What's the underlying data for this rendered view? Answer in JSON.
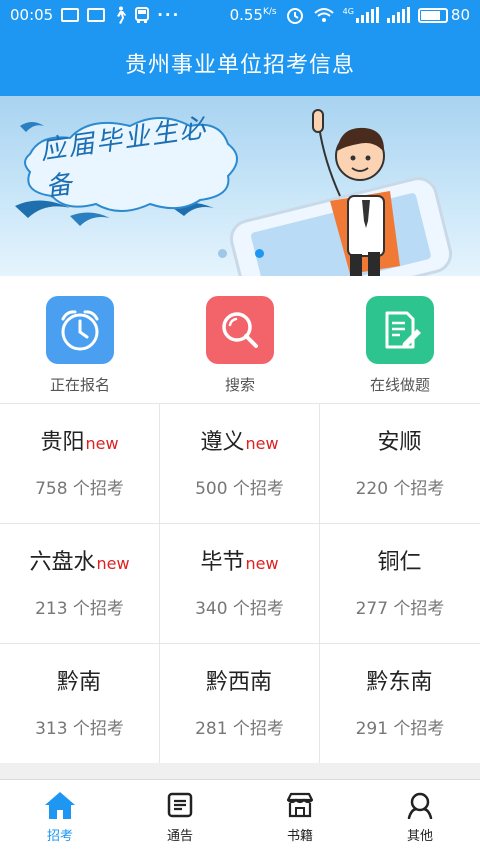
{
  "status_bar": {
    "time": "00:05",
    "more": "···",
    "speed_value": "0.55",
    "speed_unit": "K/s",
    "network_type": "4G",
    "battery_level": "80"
  },
  "header": {
    "title": "贵州事业单位招考信息"
  },
  "banner": {
    "slogan": "应届毕业生必备",
    "slide_count": 2,
    "active_slide": 2
  },
  "quick_actions": [
    {
      "label": "正在报名",
      "icon": "alarm-clock-icon",
      "color": "#4a9ff0"
    },
    {
      "label": "搜索",
      "icon": "magnifier-icon",
      "color": "#f2636a"
    },
    {
      "label": "在线做题",
      "icon": "document-edit-icon",
      "color": "#2ec48f"
    }
  ],
  "regions": [
    {
      "name": "贵阳",
      "badge": "new",
      "count": "758 个招考"
    },
    {
      "name": "遵义",
      "badge": "new",
      "count": "500 个招考"
    },
    {
      "name": "安顺",
      "badge": "",
      "count": "220 个招考"
    },
    {
      "name": "六盘水",
      "badge": "new",
      "count": "213 个招考"
    },
    {
      "name": "毕节",
      "badge": "new",
      "count": "340 个招考"
    },
    {
      "name": "铜仁",
      "badge": "",
      "count": "277 个招考"
    },
    {
      "name": "黔南",
      "badge": "",
      "count": "313 个招考"
    },
    {
      "name": "黔西南",
      "badge": "",
      "count": "281 个招考"
    },
    {
      "name": "黔东南",
      "badge": "",
      "count": "291 个招考"
    }
  ],
  "bottom_nav": [
    {
      "label": "招考",
      "icon": "home-icon",
      "active": true
    },
    {
      "label": "通告",
      "icon": "notice-icon",
      "active": false
    },
    {
      "label": "书籍",
      "icon": "bookstore-icon",
      "active": false
    },
    {
      "label": "其他",
      "icon": "person-icon",
      "active": false
    }
  ],
  "colors": {
    "primary": "#1e97f3",
    "badge_red": "#e0201f"
  }
}
